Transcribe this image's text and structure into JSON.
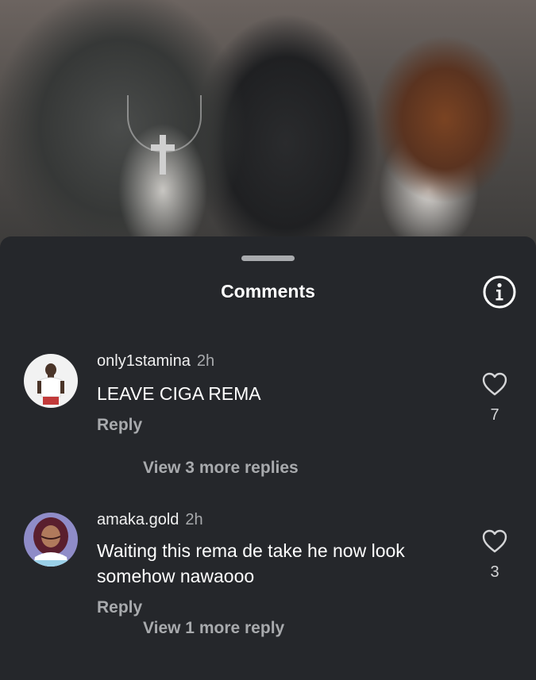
{
  "sheet": {
    "title": "Comments",
    "info_icon": "info-icon"
  },
  "comments": [
    {
      "username": "only1stamina",
      "time": "2h",
      "text": "LEAVE CIGA REMA",
      "reply_label": "Reply",
      "likes": "7",
      "view_replies": "View 3 more replies",
      "avatar_icon": "user-avatar"
    },
    {
      "username": "amaka.gold",
      "time": "2h",
      "text": "Waiting this rema de take he now look somehow nawaooo",
      "reply_label": "Reply",
      "likes": "3",
      "view_replies": "View 1 more reply",
      "avatar_icon": "user-avatar"
    }
  ],
  "colors": {
    "sheet_bg": "#25272b",
    "secondary_text": "#a8aaad",
    "primary_text": "#ffffff"
  }
}
